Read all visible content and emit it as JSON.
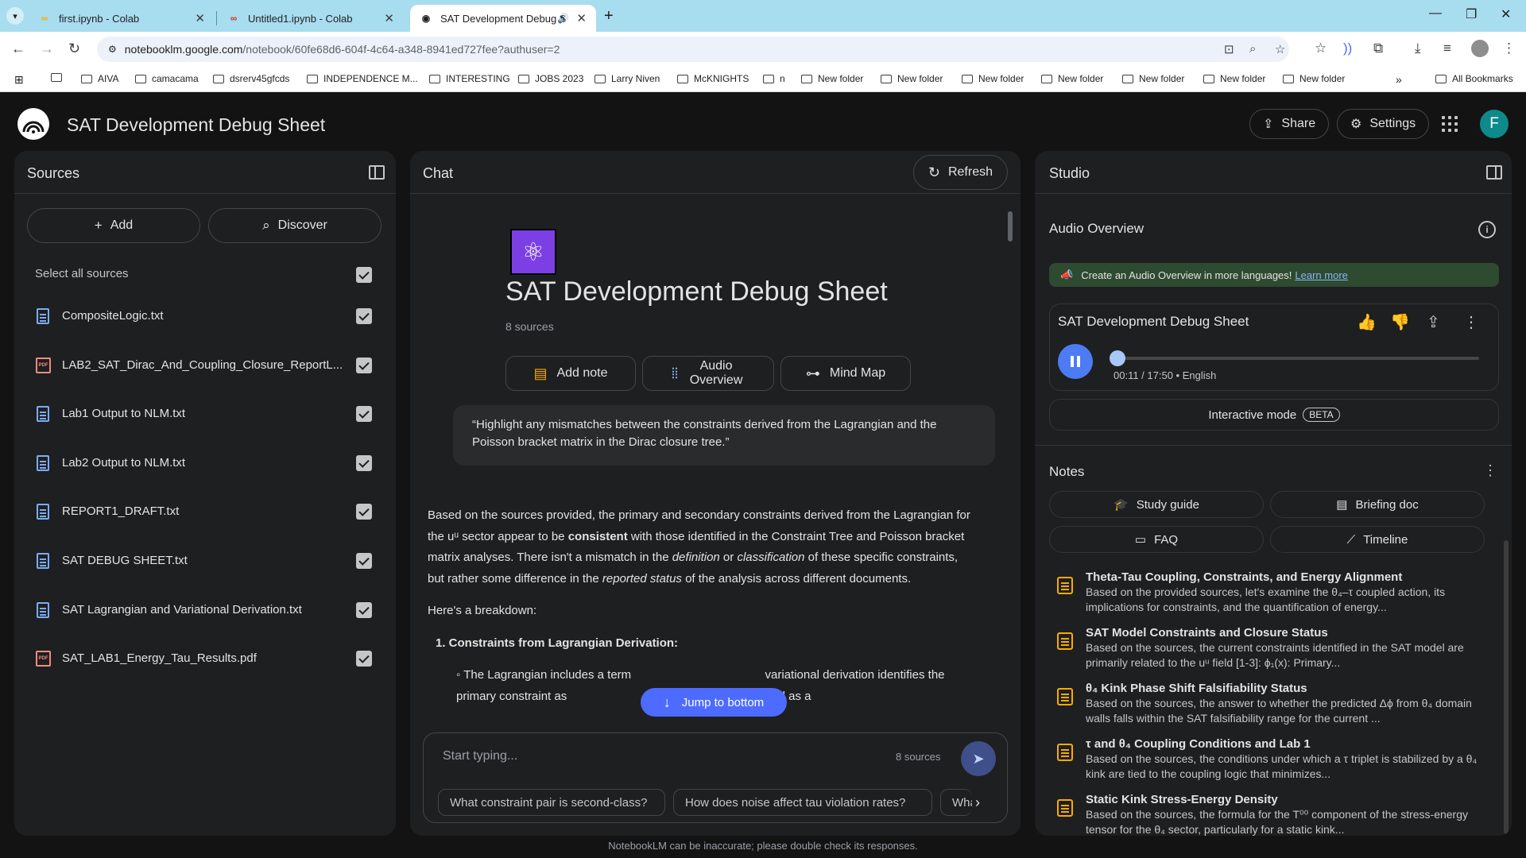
{
  "browser": {
    "tabs": [
      {
        "title": "first.ipynb - Colab",
        "favicon": "colab-icon"
      },
      {
        "title": "Untitled1.ipynb - Colab",
        "favicon": "colab-icon"
      },
      {
        "title": "SAT Development Debug S",
        "favicon": "notebooklm-icon",
        "active": true
      }
    ],
    "url_host": "notebooklm.google.com",
    "url_path": "/notebook/60fe68d6-604f-4c64-a348-8941ed727fee?authuser=2",
    "bookmarks": [
      "AIVA",
      "camacama",
      "dsrerv45gfcds",
      "INDEPENDENCE M...",
      "INTERESTING",
      "JOBS 2023",
      "Larry Niven",
      "McKNIGHTS",
      "n",
      "New folder",
      "New folder",
      "New folder",
      "New folder",
      "New folder",
      "New folder",
      "New folder"
    ],
    "all_bookmarks": "All Bookmarks"
  },
  "header": {
    "title": "SAT Development Debug Sheet",
    "share_label": "Share",
    "settings_label": "Settings",
    "avatar_initial": "F"
  },
  "sources": {
    "title": "Sources",
    "add_label": "Add",
    "discover_label": "Discover",
    "select_all_label": "Select all sources",
    "items": [
      {
        "name": "CompositeLogic.txt",
        "type": "txt"
      },
      {
        "name": "LAB2_SAT_Dirac_And_Coupling_Closure_ReportL...",
        "type": "pdf"
      },
      {
        "name": "Lab1 Output to NLM.txt",
        "type": "txt"
      },
      {
        "name": "Lab2 Output to NLM.txt",
        "type": "txt"
      },
      {
        "name": "REPORT1_DRAFT.txt",
        "type": "txt"
      },
      {
        "name": "SAT DEBUG SHEET.txt",
        "type": "txt"
      },
      {
        "name": "SAT Lagrangian and Variational Derivation.txt",
        "type": "txt"
      },
      {
        "name": "SAT_LAB1_Energy_Tau_Results.pdf",
        "type": "pdf"
      }
    ]
  },
  "chat": {
    "title": "Chat",
    "refresh_label": "Refresh",
    "notebook_title": "SAT Development Debug Sheet",
    "source_count": "8 sources",
    "actions": {
      "add_note": "Add note",
      "audio_overview": "Audio Overview",
      "mind_map": "Mind Map"
    },
    "user_message": "“Highlight any mismatches between the constraints derived from the Lagrangian and the Poisson bracket matrix in the Dirac closure tree.”",
    "answer": {
      "p1_a": "Based on the sources provided, the primary and secondary constraints derived from the Lagrangian for the uᵘ sector appear to be ",
      "p1_b": "consistent",
      "p1_c": " with those identified in the Constraint Tree and Poisson bracket matrix analyses. There isn't a mismatch in the ",
      "p1_d": "definition",
      "p1_e": " or ",
      "p1_f": "classification",
      "p1_g": " of these specific constraints, but rather some difference in the ",
      "p1_h": "reported status",
      "p1_i": " of the analysis across different documents.",
      "p2": "Here's a breakdown:",
      "li1": "1. Constraints from Lagrangian Derivation:",
      "li2_a": "◦ The Lagrangian includes a term",
      "li2_b": "variational derivation identifies the primary constraint as",
      "li2_c": ". This is described as a"
    },
    "jump_label": "Jump to bottom",
    "input_placeholder": "Start typing...",
    "input_source_count": "8 sources",
    "suggestions": [
      "What constraint pair is second-class?",
      "How does noise affect tau violation rates?",
      "Wha"
    ]
  },
  "studio": {
    "title": "Studio",
    "audio_overview_label": "Audio Overview",
    "banner_text": "Create an Audio Overview in more languages!",
    "banner_link": "Learn more",
    "audio_title": "SAT Development Debug Sheet",
    "audio_time": "00:11 / 17:50 • English",
    "audio_progress": 0.01,
    "interactive_label": "Interactive mode",
    "beta_label": "BETA",
    "notes_label": "Notes",
    "note_buttons": [
      "Study guide",
      "Briefing doc",
      "FAQ",
      "Timeline"
    ],
    "notes": [
      {
        "title": "Theta-Tau Coupling, Constraints, and Energy Alignment",
        "snippet": "Based on the provided sources, let's examine the θ₄–τ coupled action, its implications for constraints, and the quantification of energy..."
      },
      {
        "title": "SAT Model Constraints and Closure Status",
        "snippet": "Based on the sources, the current constraints identified in the SAT model are primarily related to the uᵘ field [1-3]: ϕ₁(x): Primary..."
      },
      {
        "title": "θ₄ Kink Phase Shift Falsifiability Status",
        "snippet": "Based on the sources, the answer to whether the predicted Δϕ from θ₄ domain walls falls within the SAT falsifiability range for the current ..."
      },
      {
        "title": "τ and θ₄ Coupling Conditions and Lab 1",
        "snippet": "Based on the sources, the conditions under which a τ triplet is stabilized by a θ₄ kink are tied to the coupling logic that minimizes..."
      },
      {
        "title": "Static Kink Stress-Energy Density",
        "snippet": "Based on the sources, the formula for the T⁰⁰ component of the stress-energy tensor for the θ₄ sector, particularly for a static kink..."
      }
    ]
  },
  "footer": "NotebookLM can be inaccurate; please double check its responses.",
  "colors": {
    "accent": "#4d6bfe",
    "background": "#131314",
    "panel": "#1e1f20",
    "note_icon": "#f9ab00"
  }
}
